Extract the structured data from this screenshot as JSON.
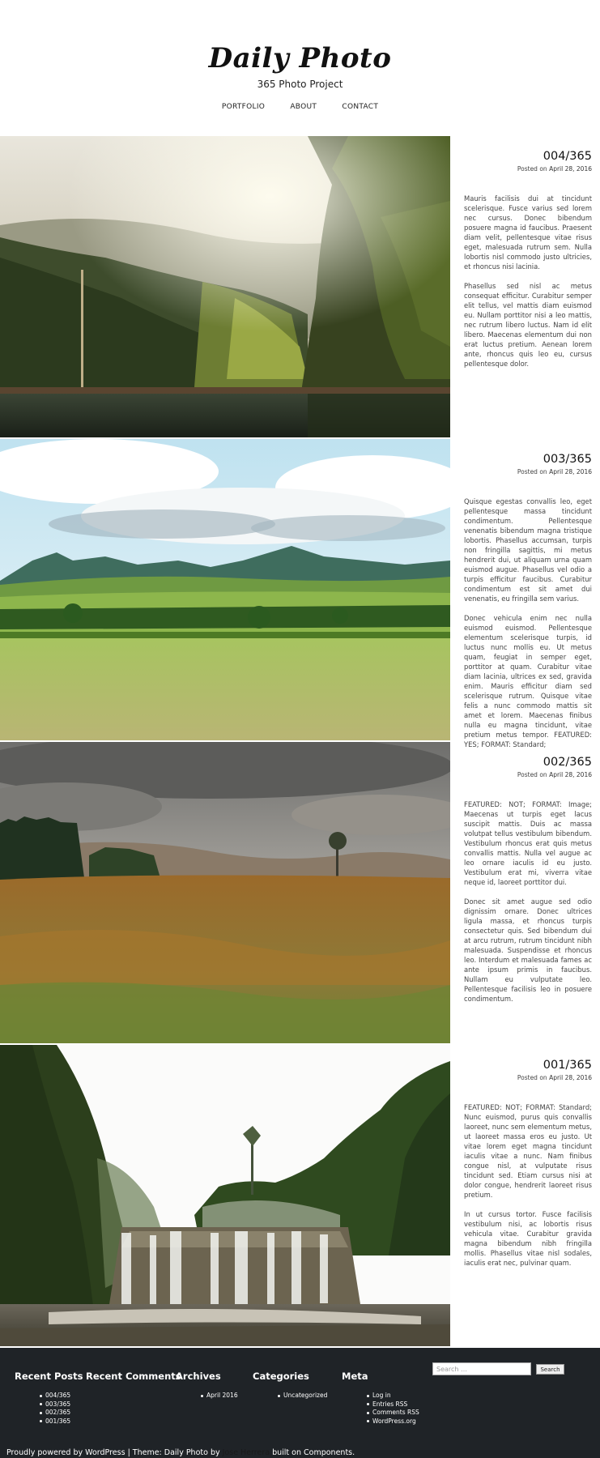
{
  "header": {
    "title": "Daily Photo",
    "description": "365 Photo Project",
    "nav": [
      "PORTFOLIO",
      "ABOUT",
      "CONTACT"
    ]
  },
  "posts": [
    {
      "title": "004/365",
      "posted_on": "Posted on",
      "date": "April 28, 2016",
      "paragraphs": [
        "Mauris facilisis dui at tincidunt scelerisque. Fusce varius sed lorem nec cursus. Donec bibendum posuere magna id faucibus. Praesent diam velit, pellentesque vitae risus eget, malesuada rutrum sem. Nulla lobortis nisl commodo justo ultricies, et rhoncus nisi lacinia.",
        "Phasellus sed nisl ac metus consequat efficitur. Curabitur semper elit tellus, vel mattis diam euismod eu. Nullam porttitor nisi a leo mattis, nec rutrum libero luctus. Nam id elit libero. Maecenas elementum dui non erat luctus pretium. Aenean lorem ante, rhoncus quis leo eu, cursus pellentesque dolor."
      ]
    },
    {
      "title": "003/365",
      "posted_on": "Posted on",
      "date": "April 28, 2016",
      "paragraphs": [
        "Quisque egestas convallis leo, eget pellentesque massa tincidunt condimentum. Pellentesque venenatis bibendum magna tristique lobortis. Phasellus accumsan, turpis non fringilla sagittis, mi metus hendrerit dui, ut aliquam urna quam euismod augue. Phasellus vel odio a turpis efficitur faucibus. Curabitur condimentum est sit amet dui venenatis, eu fringilla sem varius.",
        "Donec vehicula enim nec nulla euismod euismod. Pellentesque elementum scelerisque turpis, id luctus nunc mollis eu. Ut metus quam, feugiat in semper eget, porttitor at quam. Curabitur vitae diam lacinia, ultrices ex sed, gravida enim. Mauris efficitur diam sed scelerisque rutrum. Quisque vitae felis a nunc commodo mattis sit amet et lorem. Maecenas finibus nulla eu magna tincidunt, vitae pretium metus tempor. FEATURED: YES; FORMAT: Standard;"
      ]
    },
    {
      "title": "002/365",
      "posted_on": "Posted on",
      "date": "April 28, 2016",
      "paragraphs": [
        "FEATURED: NOT; FORMAT: Image; Maecenas ut turpis eget lacus suscipit mattis. Duis ac massa volutpat tellus vestibulum bibendum. Vestibulum rhoncus erat quis metus convallis mattis. Nulla vel augue ac leo ornare iaculis id eu justo. Vestibulum erat mi, viverra vitae neque id, laoreet porttitor dui.",
        "Donec sit amet augue sed odio dignissim ornare. Donec ultrices ligula massa, et rhoncus turpis consectetur quis. Sed bibendum dui at arcu rutrum, rutrum tincidunt nibh malesuada. Suspendisse et rhoncus leo. Interdum et malesuada fames ac ante ipsum primis in faucibus. Nullam eu vulputate leo. Pellentesque facilisis leo in posuere condimentum."
      ]
    },
    {
      "title": "001/365",
      "posted_on": "Posted on",
      "date": "April 28, 2016",
      "paragraphs": [
        "FEATURED: NOT; FORMAT: Standard; Nunc euismod, purus quis convallis laoreet, nunc sem elementum metus, ut laoreet massa eros eu justo. Ut vitae lorem eget magna tincidunt iaculis vitae a nunc. Nam finibus congue nisl, at vulputate risus tincidunt sed. Etiam cursus nisi at dolor congue, hendrerit laoreet risus pretium.",
        "In ut cursus tortor. Fusce facilisis vestibulum nisi, ac lobortis risus vehicula vitae. Curabitur gravida magna bibendum nibh fringilla mollis. Phasellus vitae nisl sodales, iaculis erat nec, pulvinar quam."
      ]
    }
  ],
  "footer": {
    "widgets": {
      "recent_posts": {
        "title": "Recent Posts",
        "items": [
          "004/365",
          "003/365",
          "002/365",
          "001/365"
        ]
      },
      "recent_comments": {
        "title": "Recent Comments"
      },
      "archives": {
        "title": "Archives",
        "items": [
          "April 2016"
        ]
      },
      "categories": {
        "title": "Categories",
        "items": [
          "Uncategorized"
        ]
      },
      "meta": {
        "title": "Meta",
        "items": [
          "Log in",
          "Entries RSS",
          "Comments RSS",
          "WordPress.org"
        ]
      }
    },
    "search": {
      "placeholder": "Search …",
      "button": "Search"
    },
    "credits": {
      "before": "Proudly powered by WordPress | Theme: Daily Photo by ",
      "author": "Jose Herrera",
      "after": " built on Components."
    }
  }
}
